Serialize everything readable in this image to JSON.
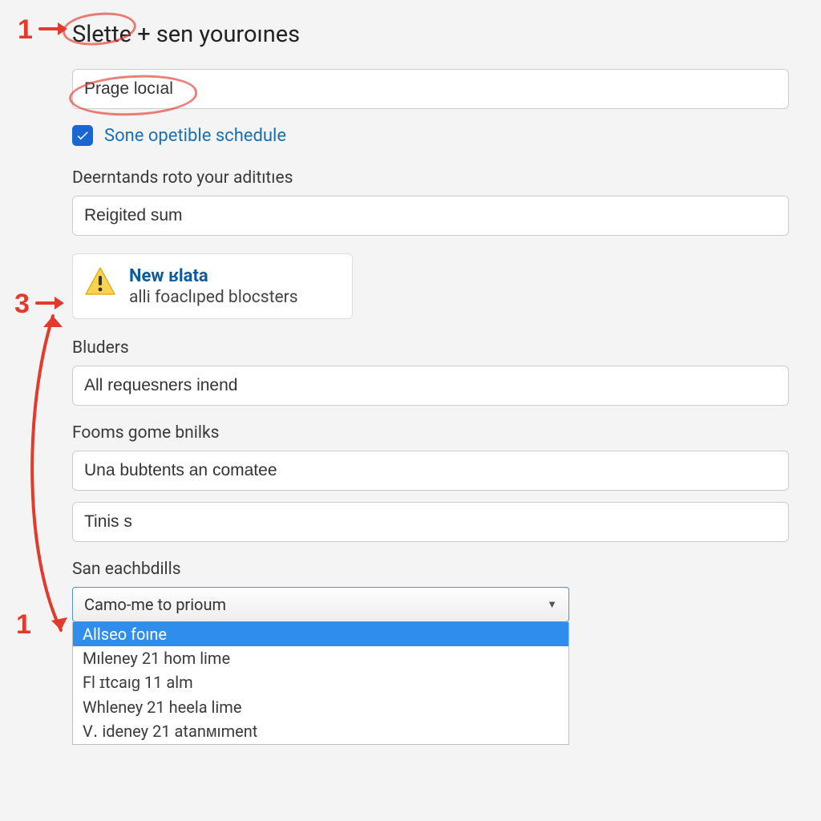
{
  "title": "Slette + sen youroınes",
  "input1_value": "Prage locıal",
  "checkbox": {
    "checked": true,
    "label": "Sone opetible schedule"
  },
  "field_deerntands": {
    "label": "Deerntands roto your aditıtıes",
    "value": "Reigited sum"
  },
  "alert": {
    "title": "New ʁlata",
    "sub": "alli foaclıped blocsters"
  },
  "bluders": {
    "label": "Bluders",
    "value": "All requesners inend"
  },
  "fooms": {
    "label": "Fooms gome bnilks",
    "value1": "Una bubtents an comatee",
    "value2": "Tinis s"
  },
  "san": {
    "label": "San eachbdills",
    "selected": "Camo-me to prioum",
    "options": [
      "Allseo foıne",
      "Mıleney 21 hom lime",
      "Fl ɪtcaıɡ 11 alm",
      "Whleney 21 heela lime",
      "V․ ideney 21 atanᴍıment"
    ],
    "highlight_index": 0
  },
  "annotations": {
    "n1": "1",
    "n3": "3",
    "n1b": "1"
  }
}
